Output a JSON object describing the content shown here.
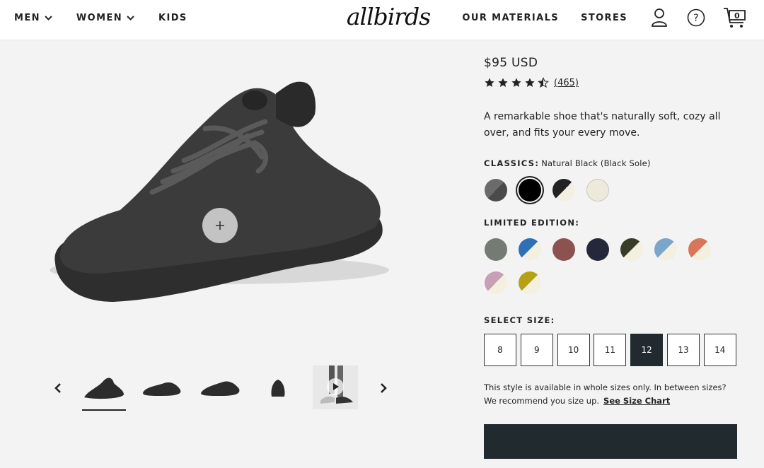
{
  "header": {
    "nav_left": [
      {
        "label": "MEN",
        "has_dropdown": true
      },
      {
        "label": "WOMEN",
        "has_dropdown": true
      },
      {
        "label": "KIDS",
        "has_dropdown": false
      }
    ],
    "logo": "allbirds",
    "nav_right": [
      {
        "label": "OUR MATERIALS"
      },
      {
        "label": "STORES"
      }
    ],
    "icons": [
      "account-icon",
      "help-icon",
      "cart-icon"
    ],
    "cart_count": "0"
  },
  "gallery": {
    "zoom_icon": "plus-icon",
    "thumbnails": [
      "shoe-angle",
      "shoe-side",
      "shoe-side-pair",
      "shoe-back",
      "video-on-foot"
    ],
    "active_thumbnail": 0
  },
  "product": {
    "price": "$95 USD",
    "rating": 4.5,
    "reviews": "(465)",
    "description": "A remarkable shoe that's naturally soft, cozy all over, and fits your every move.",
    "classics_label": "CLASSICS:",
    "classics_selected": "Natural Black (Black Sole)",
    "classics": [
      {
        "name": "grey-dark",
        "color_a": "#6b6b6b",
        "color_b": "#4a4a4a"
      },
      {
        "name": "natural-black",
        "color_a": "#000000",
        "color_b": "#000000"
      },
      {
        "name": "black-white-sole",
        "color_a": "#232323",
        "color_b": "#f3f0e3"
      },
      {
        "name": "natural-white",
        "color_a": "#eeeadb",
        "color_b": "#eeeadb"
      }
    ],
    "limited_label": "LIMITED EDITION:",
    "limited": [
      {
        "name": "sage",
        "color_a": "#737b72",
        "color_b": "#737b72"
      },
      {
        "name": "blue-white",
        "color_a": "#2e6fb5",
        "color_b": "#f4f0e0"
      },
      {
        "name": "rose-brown",
        "color_a": "#8b5250",
        "color_b": "#8b5250"
      },
      {
        "name": "navy",
        "color_a": "#24283a",
        "color_b": "#24283a"
      },
      {
        "name": "olive-white",
        "color_a": "#383d29",
        "color_b": "#f4f0e0"
      },
      {
        "name": "sky-white",
        "color_a": "#7aa6cc",
        "color_b": "#f4f0e0"
      },
      {
        "name": "coral-white",
        "color_a": "#d9765a",
        "color_b": "#f4f0e0"
      },
      {
        "name": "lilac-white",
        "color_a": "#c7a0b5",
        "color_b": "#f4f0e0"
      },
      {
        "name": "mustard-white",
        "color_a": "#b5a112",
        "color_b": "#f4f0e0"
      }
    ],
    "size_label": "SELECT SIZE:",
    "sizes": [
      "8",
      "9",
      "10",
      "11",
      "12",
      "13",
      "14"
    ],
    "selected_size": "12",
    "size_note": "This style is available in whole sizes only. In between sizes? We recommend you size up.",
    "size_chart_link": "See Size Chart"
  },
  "colors": {
    "primary_dark": "#212a2f",
    "background": "#f3f3f3"
  }
}
